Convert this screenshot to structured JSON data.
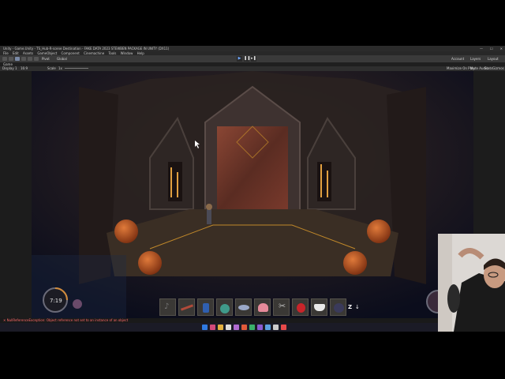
{
  "window": {
    "title": "Unity - Game.Unity - TS_Hub-R-scene Destination - FAKE DATA 2023 STEWBEN PACKAGE IN UNITY (DX11)",
    "controls": [
      "—",
      "☐",
      "✕"
    ]
  },
  "menu": {
    "items": [
      "File",
      "Edit",
      "Assets",
      "GameObject",
      "Component",
      "Cinemachine",
      "Tools",
      "Window",
      "Help"
    ]
  },
  "toolbar": {
    "account_label": "Account",
    "layers_label": "Layers",
    "layout_label": "Layout",
    "pivot_label": "Pivot",
    "global_label": "Global",
    "play_controls": [
      "▶",
      "❚❚",
      "▸❚"
    ]
  },
  "tabs": {
    "game_tab": "Game"
  },
  "game_view": {
    "display_label": "Display 1",
    "aspect_label": "16:9",
    "scale_label": "Scale",
    "scale_value": "1x",
    "right_options": [
      "Maximize On Play",
      "Mute Audio",
      "Stats",
      "Gizmos"
    ]
  },
  "console": {
    "message": "✕ NullReferenceException: Object reference not set to an instance of an object"
  },
  "hud": {
    "timer_text": "7:19",
    "zoom_key": "Z",
    "zoom_arrow": "↓",
    "inventory": [
      {
        "icon": "bell-icon",
        "selected": false
      },
      {
        "icon": "flute-icon",
        "selected": false
      },
      {
        "icon": "potion-bottle-icon",
        "selected": false
      },
      {
        "icon": "flask-icon",
        "selected": false
      },
      {
        "icon": "fish-icon",
        "selected": false
      },
      {
        "icon": "shell-icon",
        "selected": false
      },
      {
        "icon": "scissors-icon",
        "selected": false
      },
      {
        "icon": "strawberry-icon",
        "selected": false
      },
      {
        "icon": "teacup-icon",
        "selected": false
      },
      {
        "icon": "pot-icon",
        "selected": false
      }
    ]
  },
  "colors": {
    "editor_dark": "#1c1c1c",
    "game_background": "#0a0c1e",
    "orb_color": "#b5501f",
    "gold_trim": "#c0882a",
    "error_text": "#ff6a6a"
  }
}
